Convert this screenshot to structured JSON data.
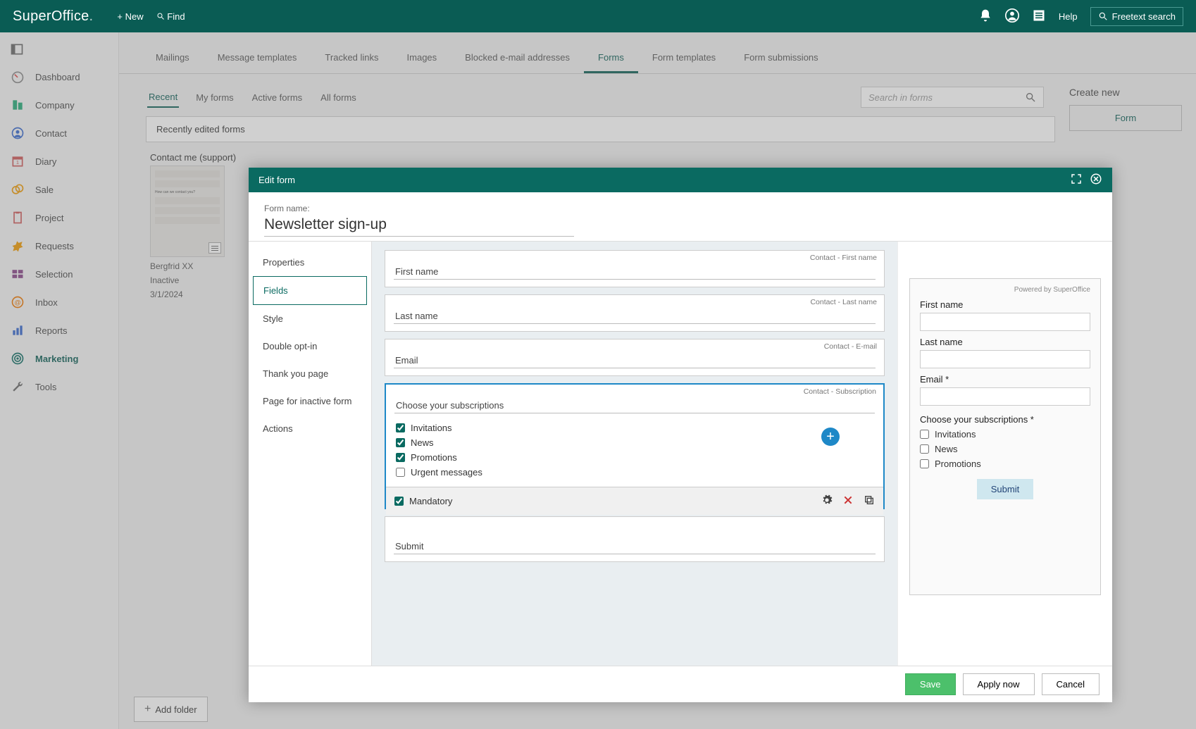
{
  "app": {
    "name": "SuperOffice",
    "new": "New",
    "find": "Find",
    "help": "Help",
    "freetext": "Freetext search"
  },
  "nav": {
    "dashboard": "Dashboard",
    "company": "Company",
    "contact": "Contact",
    "diary": "Diary",
    "sale": "Sale",
    "project": "Project",
    "requests": "Requests",
    "selection": "Selection",
    "inbox": "Inbox",
    "reports": "Reports",
    "marketing": "Marketing",
    "tools": "Tools"
  },
  "tabs1": {
    "mailings": "Mailings",
    "templates": "Message templates",
    "tracked": "Tracked links",
    "images": "Images",
    "blocked": "Blocked e-mail addresses",
    "forms": "Forms",
    "formtpl": "Form templates",
    "submissions": "Form submissions"
  },
  "tabs2": {
    "recent": "Recent",
    "my": "My forms",
    "active": "Active forms",
    "all": "All forms",
    "search": "Search in forms"
  },
  "recent_label": "Recently edited forms",
  "create": {
    "title": "Create new",
    "form": "Form"
  },
  "card": {
    "title": "Contact me (support)",
    "author": "Bergfrid XX",
    "status": "Inactive",
    "date": "3/1/2024"
  },
  "addfolder": "Add folder",
  "modal": {
    "title": "Edit form",
    "name_lbl": "Form name:",
    "name_val": "Newsletter sign-up",
    "nav": {
      "properties": "Properties",
      "fields": "Fields",
      "style": "Style",
      "doubleopt": "Double opt-in",
      "thanks": "Thank you page",
      "inactive": "Page for inactive form",
      "actions": "Actions"
    },
    "fields": {
      "fn_tag": "Contact - First name",
      "fn": "First name",
      "ln_tag": "Contact - Last name",
      "ln": "Last name",
      "em_tag": "Contact - E-mail",
      "em": "Email",
      "sub_tag": "Contact - Subscription",
      "sub": "Choose your subscriptions",
      "inv": "Invitations",
      "news": "News",
      "promo": "Promotions",
      "urgent": "Urgent messages",
      "mandatory": "Mandatory",
      "submit": "Submit"
    },
    "preview": {
      "powered": "Powered by SuperOffice",
      "fn": "First name",
      "ln": "Last name",
      "em": "Email *",
      "sub": "Choose your subscriptions *",
      "inv": "Invitations",
      "news": "News",
      "promo": "Promotions",
      "submit": "Submit"
    },
    "buttons": {
      "save": "Save",
      "apply": "Apply now",
      "cancel": "Cancel"
    }
  }
}
